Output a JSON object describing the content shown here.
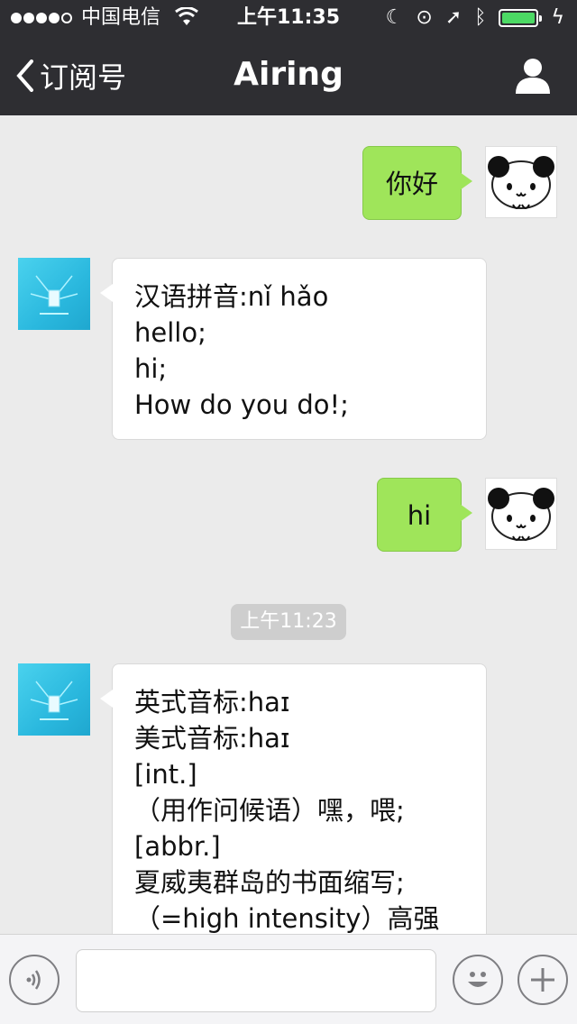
{
  "status_bar": {
    "carrier": "中国电信",
    "time": "上午11:35"
  },
  "nav": {
    "back_label": "订阅号",
    "title": "Airing"
  },
  "messages": [
    {
      "sender": "me",
      "lines": [
        "你好"
      ]
    },
    {
      "sender": "bot",
      "lines": [
        "汉语拼音:nǐ hǎo",
        "hello;",
        "hi;",
        "How do you do!;"
      ]
    },
    {
      "sender": "me",
      "lines": [
        "hi"
      ]
    },
    {
      "sender": "bot",
      "lines": [
        "英式音标:haɪ",
        "美式音标:haɪ",
        "[int.]",
        "（用作问候语）嘿，喂;",
        "[abbr.]",
        "夏威夷群岛的书面缩写;",
        "（=high intensity）高强"
      ]
    }
  ],
  "timestamp": "上午11:23",
  "input_bar": {
    "voice_icon": "voice-icon",
    "emoji_icon": "emoji-icon",
    "plus_icon": "plus-icon",
    "text_value": ""
  },
  "colors": {
    "nav_bg": "#2e2e32",
    "chat_bg": "#ebebeb",
    "my_bubble": "#9fe55a",
    "bot_bubble": "#ffffff",
    "battery": "#4cd964"
  }
}
